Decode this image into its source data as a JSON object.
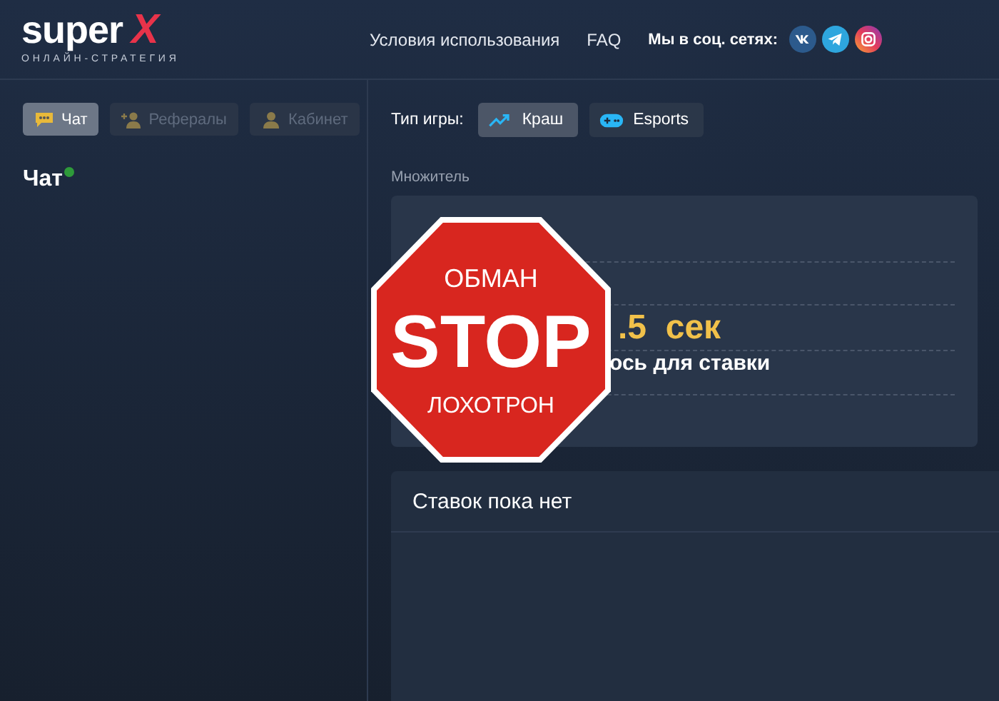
{
  "header": {
    "logo": {
      "word": "super",
      "mark": "X",
      "tagline": "ОНЛАЙН-СТРАТЕГИЯ"
    },
    "nav": [
      "Условия использования",
      "FAQ"
    ],
    "social": {
      "label": "Мы в соц. сетях:",
      "networks": [
        {
          "kind": "vk"
        },
        {
          "kind": "telegram"
        },
        {
          "kind": "instagram"
        }
      ]
    }
  },
  "sidebar": {
    "tabs": [
      {
        "label": "Чат",
        "kind": "chat",
        "selected": true
      },
      {
        "label": "Рефералы",
        "kind": "referrals",
        "selected": false
      },
      {
        "label": "Кабинет",
        "kind": "account",
        "selected": false
      }
    ],
    "chat": {
      "title": "Чат",
      "online": true
    }
  },
  "game": {
    "label": "Тип игры:",
    "types": [
      {
        "label": "Краш",
        "kind": "crash",
        "selected": true
      },
      {
        "label": "Esports",
        "kind": "esports",
        "selected": false
      }
    ],
    "multiplier_label": "Множитель",
    "countdown": ".5  сек",
    "countdown_note": "ось для ставки"
  },
  "bets": {
    "title": "Ставок пока нет"
  },
  "overlay": {
    "top": "ОБМАН",
    "main": "STOP",
    "bottom": "ЛОХОТРОН"
  }
}
